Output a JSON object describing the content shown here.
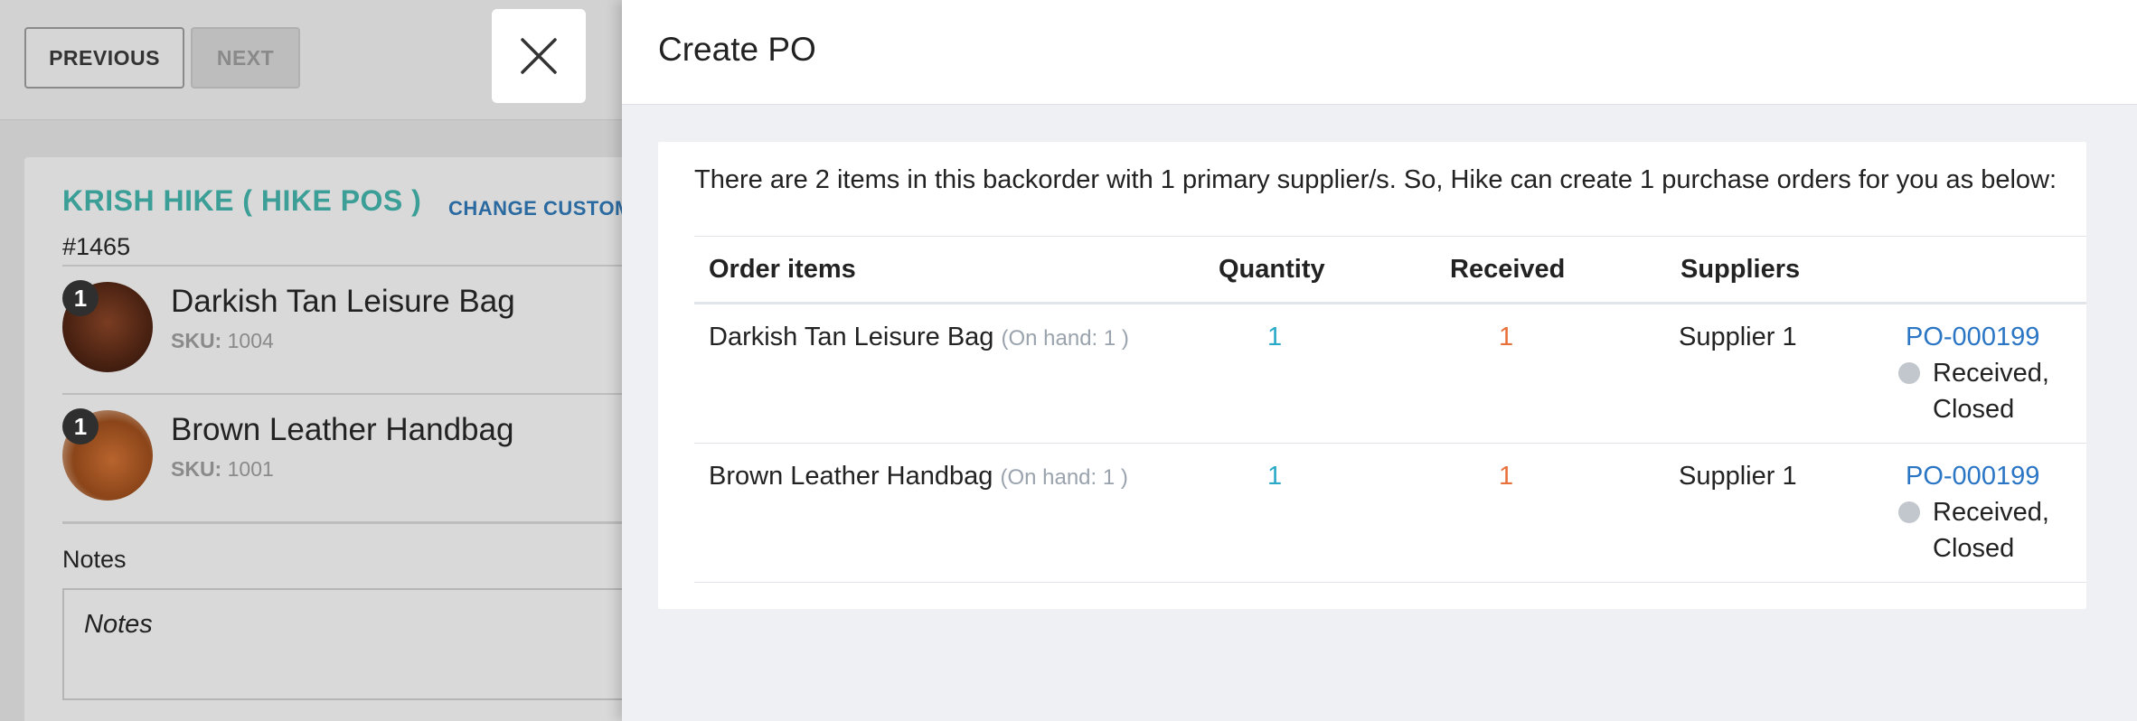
{
  "background": {
    "nav": {
      "previous_label": "PREVIOUS",
      "next_label": "NEXT"
    },
    "customer": {
      "name": "KRISH HIKE ( HIKE POS )",
      "change_label": "CHANGE CUSTOMER",
      "order_number": "#1465"
    },
    "products": [
      {
        "qty": "1",
        "name": "Darkish Tan Leisure Bag",
        "sku_label": "SKU:",
        "sku": "1004"
      },
      {
        "qty": "1",
        "name": "Brown Leather Handbag",
        "sku_label": "SKU:",
        "sku": "1001"
      }
    ],
    "notes": {
      "label": "Notes",
      "placeholder": "Notes"
    }
  },
  "panel": {
    "title": "Create PO",
    "intro": "There are 2 items in this backorder with 1 primary supplier/s. So, Hike can create 1 purchase orders for you as below:",
    "table": {
      "headers": {
        "items": "Order items",
        "quantity": "Quantity",
        "received": "Received",
        "suppliers": "Suppliers"
      },
      "rows": [
        {
          "item": "Darkish Tan Leisure Bag",
          "onhand": "(On hand: 1 )",
          "quantity": "1",
          "received": "1",
          "supplier": "Supplier 1",
          "po": "PO-000199",
          "status_line1": "Received,",
          "status_line2": "Closed"
        },
        {
          "item": "Brown Leather Handbag",
          "onhand": "(On hand: 1 )",
          "quantity": "1",
          "received": "1",
          "supplier": "Supplier 1",
          "po": "PO-000199",
          "status_line1": "Received,",
          "status_line2": "Closed"
        }
      ]
    }
  },
  "colors": {
    "accent_teal": "#3c9f97",
    "quantity": "#29a9c7",
    "received": "#e8703a",
    "link": "#2a75c4",
    "status_dot": "#c2c7cd"
  },
  "icons": {
    "close": "close-icon",
    "status": "status-dot-icon"
  }
}
